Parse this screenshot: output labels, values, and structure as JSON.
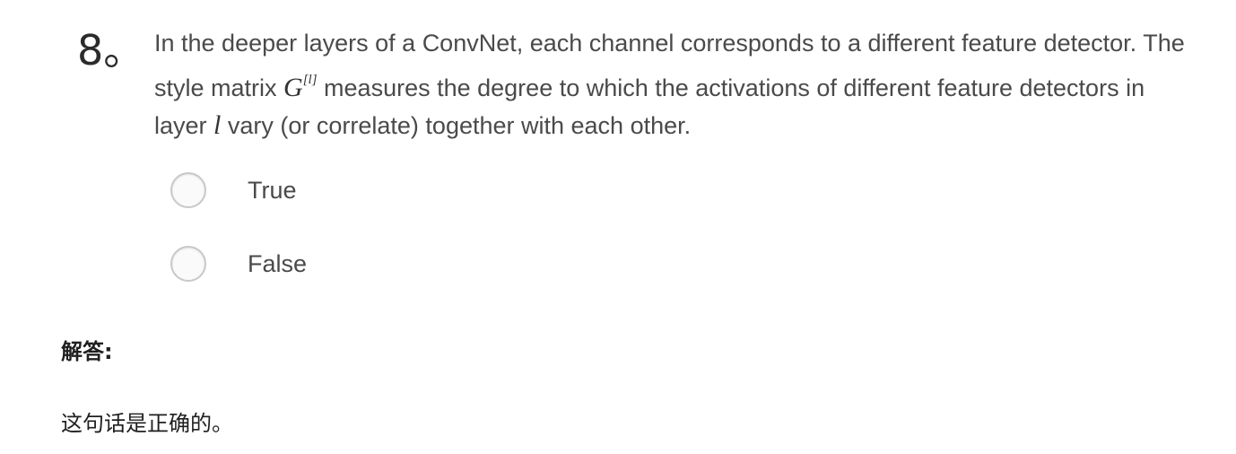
{
  "question": {
    "number": "8。",
    "text_part1": "In the deeper layers of a ConvNet, each channel corresponds to a different feature detector. The style matrix ",
    "matrix_symbol": "G",
    "matrix_superscript": "[l]",
    "text_part2": " measures the degree to which the activations of different feature detectors in layer ",
    "layer_symbol": "l",
    "text_part3": " vary (or correlate) together with each other."
  },
  "options": [
    {
      "label": "True"
    },
    {
      "label": "False"
    }
  ],
  "answer": {
    "label": "解答:",
    "text": "这句话是正确的。"
  }
}
